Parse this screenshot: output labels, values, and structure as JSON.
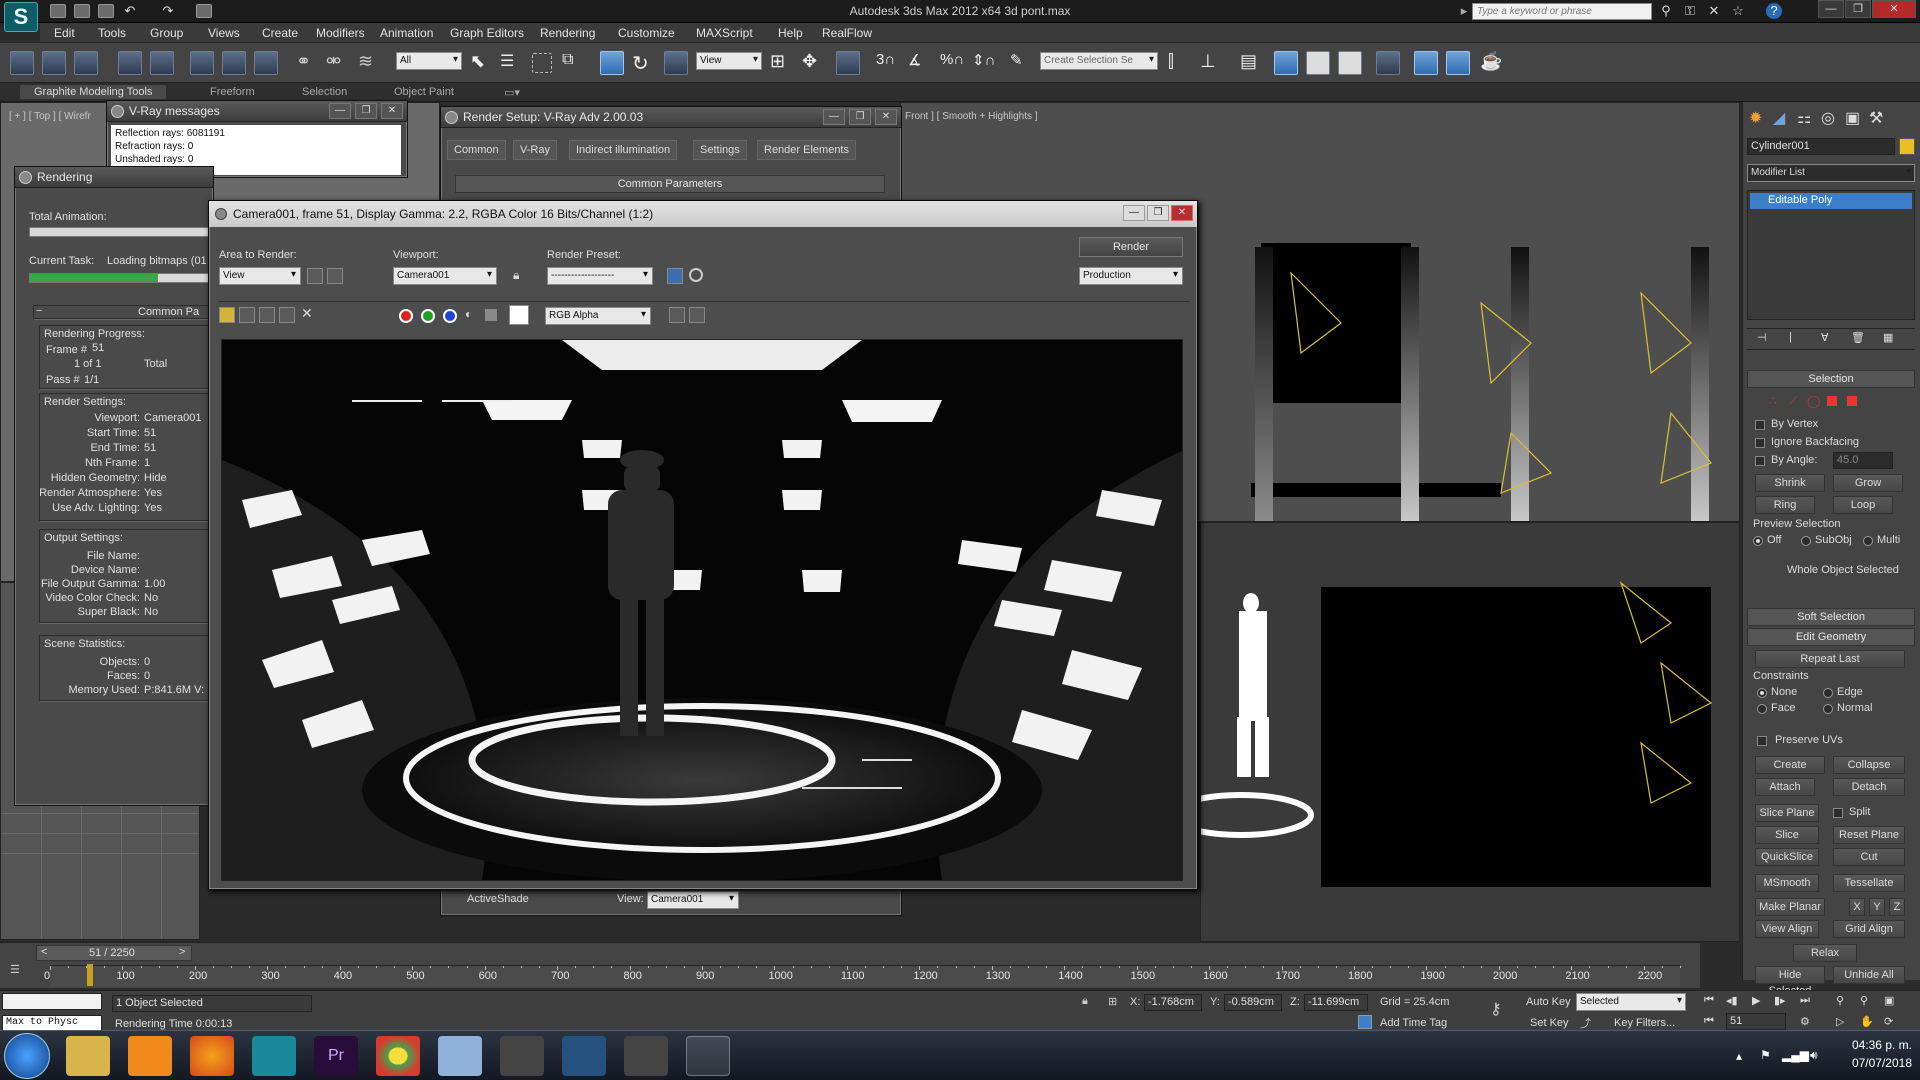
{
  "app": {
    "title": "Autodesk 3ds Max  2012 x64     3d pont.max",
    "search_placeholder": "Type a keyword or phrase"
  },
  "menu": [
    "Edit",
    "Tools",
    "Group",
    "Views",
    "Create",
    "Modifiers",
    "Animation",
    "Graph Editors",
    "Rendering",
    "Customize",
    "MAXScript",
    "Help",
    "RealFlow"
  ],
  "toolbar": {
    "selection_filter": "All",
    "reference_coord": "View",
    "named_selection": "Create Selection Se"
  },
  "ribbon": {
    "tabs": [
      "Graphite Modeling Tools",
      "Freeform",
      "Selection",
      "Object Paint"
    ]
  },
  "viewports": {
    "top_left_label": "[ + ] [ Top ] [ Wirefr",
    "front_label": "Front ] [ Smooth + Highlights ]"
  },
  "vray_messages": {
    "title": "V-Ray messages",
    "lines": [
      "Reflection rays: 6081191",
      "Refraction rays: 0",
      "Unshaded rays: 0"
    ]
  },
  "rendering": {
    "title": "Rendering",
    "total_animation_label": "Total Animation:",
    "current_task_label": "Current Task:",
    "current_task_value": "Loading bitmaps (01",
    "common_params": "Common Pa",
    "progress_section": "Rendering Progress:",
    "frame_label": "Frame #",
    "frame_value": "51",
    "of_text": "1 of 1",
    "total_label": "Total",
    "pass_label": "Pass #",
    "pass_value": "1/1",
    "settings_section": "Render Settings:",
    "settings": [
      {
        "label": "Viewport:",
        "value": "Camera001"
      },
      {
        "label": "Start Time:",
        "value": "51"
      },
      {
        "label": "End Time:",
        "value": "51"
      },
      {
        "label": "Nth Frame:",
        "value": "1"
      },
      {
        "label": "Hidden Geometry:",
        "value": "Hide"
      },
      {
        "label": "Render Atmosphere:",
        "value": "Yes"
      },
      {
        "label": "Use Adv. Lighting:",
        "value": "Yes"
      }
    ],
    "output_section": "Output Settings:",
    "output": [
      {
        "label": "File Name:",
        "value": ""
      },
      {
        "label": "Device Name:",
        "value": ""
      },
      {
        "label": "File Output Gamma:",
        "value": "1.00"
      },
      {
        "label": "Video Color Check:",
        "value": "No"
      },
      {
        "label": "Super Black:",
        "value": "No"
      }
    ],
    "scene_section": "Scene Statistics:",
    "scene": [
      {
        "label": "Objects:",
        "value": "0"
      },
      {
        "label": "Faces:",
        "value": "0"
      },
      {
        "label": "Memory Used:",
        "value": "P:841.6M V:"
      }
    ],
    "total_animation_progress": 0.0,
    "current_task_progress": 0.72
  },
  "render_setup": {
    "title": "Render Setup: V-Ray Adv 2.00.03",
    "tabs": [
      "Common",
      "V-Ray",
      "Indirect illumination",
      "Settings",
      "Render Elements"
    ],
    "common_parameters": "Common Parameters",
    "activeshade": "ActiveShade",
    "view_label": "View:",
    "view_value": "Camera001"
  },
  "frame_buffer": {
    "title": "Camera001, frame 51, Display Gamma: 2.2, RGBA Color 16 Bits/Channel (1:2)",
    "area_label": "Area to Render:",
    "area_value": "View",
    "viewport_label": "Viewport:",
    "viewport_value": "Camera001",
    "preset_label": "Render Preset:",
    "preset_value": "-------------------",
    "render_button": "Render",
    "production_value": "Production",
    "channel_value": "RGB Alpha"
  },
  "command_panel": {
    "object_name": "Cylinder001",
    "modifier_list": "Modifier List",
    "stack_item": "Editable Poly",
    "selection_title": "Selection",
    "by_vertex": "By Vertex",
    "ignore_backfacing": "Ignore Backfacing",
    "by_angle": "By Angle:",
    "angle_value": "45.0",
    "shrink": "Shrink",
    "grow": "Grow",
    "ring": "Ring",
    "loop": "Loop",
    "preview_selection": "Preview Selection",
    "preview_options": [
      "Off",
      "SubObj",
      "Multi"
    ],
    "whole_object": "Whole Object Selected",
    "soft_selection": "Soft Selection",
    "edit_geometry": "Edit Geometry",
    "repeat_last": "Repeat Last",
    "constraints": "Constraints",
    "constraint_options": [
      "None",
      "Edge",
      "Face",
      "Normal"
    ],
    "preserve_uvs": "Preserve UVs",
    "create": "Create",
    "collapse": "Collapse",
    "attach": "Attach",
    "detach": "Detach",
    "slice_plane": "Slice Plane",
    "split": "Split",
    "slice": "Slice",
    "reset_plane": "Reset Plane",
    "quickslice": "QuickSlice",
    "cut": "Cut",
    "msmooth": "MSmooth",
    "tessellate": "Tessellate",
    "make_planar": "Make Planar",
    "x": "X",
    "y": "Y",
    "z": "Z",
    "view_align": "View Align",
    "grid_align": "Grid Align",
    "relax": "Relax",
    "hide_selected": "Hide Selected",
    "unhide_all": "Unhide All"
  },
  "timeline": {
    "frame_display": "51 / 2250",
    "ticks": [
      "0",
      "100",
      "200",
      "300",
      "400",
      "500",
      "600",
      "700",
      "800",
      "900",
      "1000",
      "1100",
      "1200",
      "1300",
      "1400",
      "1500",
      "1600",
      "1700",
      "1800",
      "1900",
      "2000",
      "2100",
      "2200"
    ],
    "current_frame": 51,
    "total_frames": 2250
  },
  "status": {
    "maxscript": "Max to Physc",
    "selection": "1 Object Selected",
    "render_time": "Rendering Time  0:00:13",
    "x_label": "X:",
    "x_value": "-1.768cm",
    "y_label": "Y:",
    "y_value": "-0.589cm",
    "z_label": "Z:",
    "z_value": "-11.699cm",
    "grid": "Grid = 25.4cm",
    "add_time_tag": "Add Time Tag",
    "auto_key": "Auto Key",
    "set_key": "Set Key",
    "key_filters": "Key Filters...",
    "selected_value": "Selected",
    "frame_field": "51"
  },
  "taskbar": {
    "time": "04:36 p. m.",
    "date": "07/07/2018"
  }
}
